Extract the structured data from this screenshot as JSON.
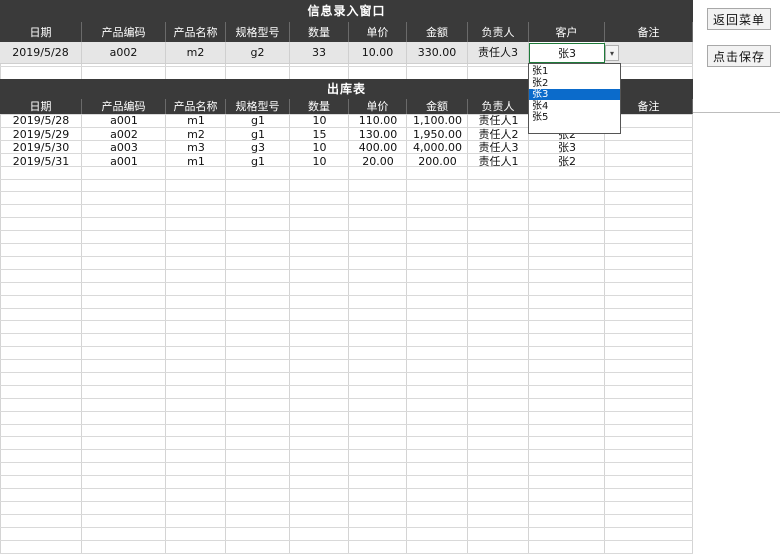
{
  "entry_window": {
    "title": "信息录入窗口",
    "headers": [
      "日期",
      "产品编码",
      "产品名称",
      "规格型号",
      "数量",
      "单价",
      "金额",
      "负责人",
      "客户",
      "备注"
    ],
    "row": [
      "2019/5/28",
      "a002",
      "m2",
      "g2",
      "33",
      "10.00",
      "330.00",
      "责任人3",
      "张3",
      ""
    ]
  },
  "outbound_table": {
    "title": "出库表",
    "headers": [
      "日期",
      "产品编码",
      "产品名称",
      "规格型号",
      "数量",
      "单价",
      "金额",
      "负责人",
      "客户",
      "备注"
    ],
    "rows": [
      [
        "2019/5/28",
        "a001",
        "m1",
        "g1",
        "10",
        "110.00",
        "1,100.00",
        "责任人1",
        "",
        ""
      ],
      [
        "2019/5/29",
        "a002",
        "m2",
        "g1",
        "15",
        "130.00",
        "1,950.00",
        "责任人2",
        "张2",
        ""
      ],
      [
        "2019/5/30",
        "a003",
        "m3",
        "g3",
        "10",
        "400.00",
        "4,000.00",
        "责任人3",
        "张3",
        ""
      ],
      [
        "2019/5/31",
        "a001",
        "m1",
        "g1",
        "10",
        "20.00",
        "200.00",
        "责任人1",
        "张2",
        ""
      ]
    ]
  },
  "customer_dropdown": {
    "selected": "张3",
    "options": [
      "张1",
      "张2",
      "张3",
      "张4",
      "张5"
    ],
    "highlighted": "张3",
    "arrow_icon": "chevron-down-icon"
  },
  "buttons": {
    "back_to_menu": "返回菜单",
    "save": "点击保存"
  },
  "colors": {
    "header_bg": "#3a3a3a",
    "header_text": "#ffffff",
    "input_row_bg": "#e6e6e6",
    "grid_line": "#d4d4d4",
    "selection": "#0b6bcb"
  }
}
